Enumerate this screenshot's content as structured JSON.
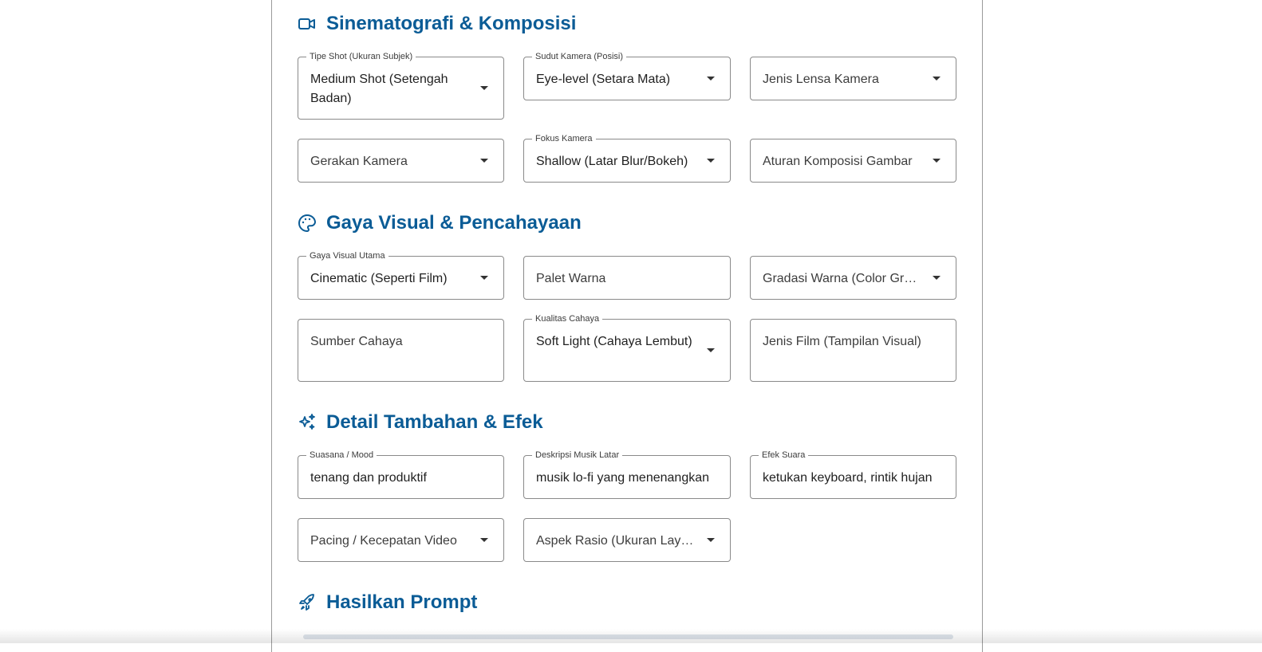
{
  "sections": [
    {
      "title": "Sinematografi & Komposisi",
      "icon": "video-camera-icon",
      "fields": [
        {
          "label": "Tipe Shot (Ukuran Subjek)",
          "value": "Medium Shot (Setengah Badan)"
        },
        {
          "label": "Sudut Kamera (Posisi)",
          "value": "Eye-level (Setara Mata)"
        },
        {
          "label": "",
          "value": "Jenis Lensa Kamera"
        },
        {
          "label": "",
          "value": "Gerakan Kamera"
        },
        {
          "label": "Fokus Kamera",
          "value": "Shallow (Latar Blur/Bokeh)"
        },
        {
          "label": "",
          "value": "Aturan Komposisi Gambar"
        }
      ]
    },
    {
      "title": "Gaya Visual & Pencahayaan",
      "icon": "palette-icon",
      "fields": [
        {
          "label": "Gaya Visual Utama",
          "value": "Cinematic (Seperti Film)"
        },
        {
          "label": "",
          "value": "Palet Warna"
        },
        {
          "label": "",
          "value": "Gradasi Warna (Color Gra…"
        },
        {
          "label": "",
          "value": "Sumber Cahaya"
        },
        {
          "label": "Kualitas Cahaya",
          "value": "Soft Light (Cahaya Lembut)"
        },
        {
          "label": "",
          "value": "Jenis Film (Tampilan Visual)"
        }
      ]
    },
    {
      "title": "Detail Tambahan & Efek",
      "icon": "sparkles-icon",
      "fields": [
        {
          "label": "Suasana / Mood",
          "value": "tenang dan produktif"
        },
        {
          "label": "Deskripsi Musik Latar",
          "value": "musik lo-fi yang menenangkan"
        },
        {
          "label": "Efek Suara",
          "value": "ketukan keyboard, rintik hujan"
        },
        {
          "label": "",
          "value": "Pacing / Kecepatan Video"
        },
        {
          "label": "",
          "value": "Aspek Rasio (Ukuran Lay…"
        }
      ]
    },
    {
      "title": "Hasilkan Prompt",
      "icon": "rocket-icon",
      "fields": []
    }
  ],
  "colors": {
    "accent": "#0b5c96",
    "border": "#8a8a8a"
  }
}
